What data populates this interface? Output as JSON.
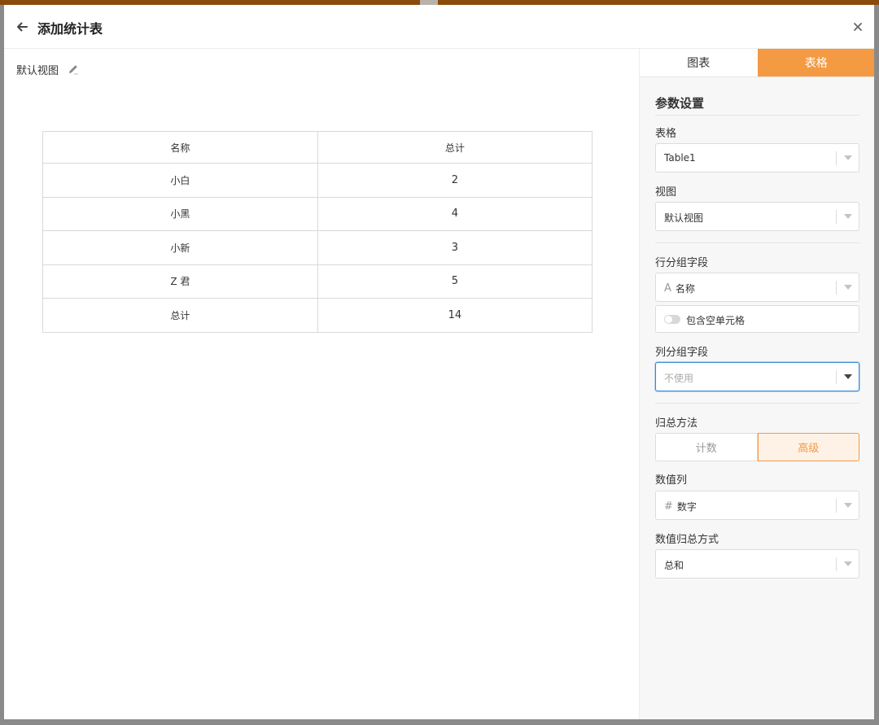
{
  "header": {
    "title": "添加统计表"
  },
  "view": {
    "name": "默认视图"
  },
  "table": {
    "columns": [
      "名称",
      "总计"
    ],
    "rows": [
      [
        "小白",
        "2"
      ],
      [
        "小黑",
        "4"
      ],
      [
        "小新",
        "3"
      ],
      [
        "Z 君",
        "5"
      ],
      [
        "总计",
        "14"
      ]
    ]
  },
  "panel": {
    "tabs": [
      "图表",
      "表格"
    ],
    "active_tab": "表格",
    "section_title": "参数设置",
    "table_field": {
      "label": "表格",
      "value": "Table1"
    },
    "view_field": {
      "label": "视图",
      "value": "默认视图"
    },
    "row_group_field": {
      "label": "行分组字段",
      "value": "名称",
      "type_icon": "A"
    },
    "include_empty": {
      "label": "包含空单元格",
      "checked": false
    },
    "col_group_field": {
      "label": "列分组字段",
      "placeholder": "不使用"
    },
    "summary_method": {
      "label": "归总方法",
      "options": [
        "计数",
        "高级"
      ],
      "selected": "高级"
    },
    "value_column": {
      "label": "数值列",
      "value": "数字",
      "type_icon": "#"
    },
    "value_summary": {
      "label": "数值归总方式",
      "value": "总和"
    }
  },
  "colors": {
    "accent": "#f39a43",
    "focus": "#3b8ad9",
    "top_strip": "#8a4a0c"
  }
}
